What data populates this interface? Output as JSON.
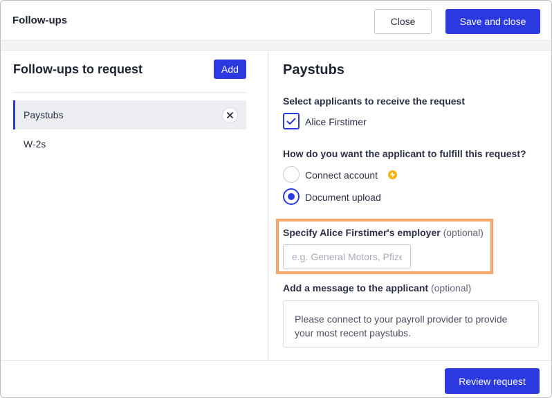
{
  "header": {
    "title": "Follow-ups",
    "close_label": "Close",
    "save_label": "Save and close"
  },
  "left": {
    "title": "Follow-ups to request",
    "add_label": "Add",
    "items": [
      {
        "label": "Paystubs",
        "active": true
      },
      {
        "label": "W-2s",
        "active": false
      }
    ]
  },
  "right": {
    "title": "Paystubs",
    "applicants_label": "Select applicants to receive the request",
    "applicant_name": "Alice Firstimer",
    "fulfill_label": "How do you want the applicant to fulfill this request?",
    "options": [
      {
        "label": "Connect account",
        "selected": false
      },
      {
        "label": "Document upload",
        "selected": true
      }
    ],
    "employer_label": "Specify Alice Firstimer's employer",
    "employer_optional": "(optional)",
    "employer_placeholder": "e.g. General Motors, Pfizer",
    "message_label": "Add a message to the applicant",
    "message_optional": "(optional)",
    "message_value": "Please connect to your payroll provider to provide your most recent paystubs."
  },
  "footer": {
    "review_label": "Review request"
  },
  "colors": {
    "accent": "#2b39e0",
    "highlight": "#f5a46a",
    "bolt": "#f5b312"
  },
  "icons": {
    "check": "check-icon",
    "remove": "close-icon",
    "bolt": "lightning-bolt-icon"
  }
}
